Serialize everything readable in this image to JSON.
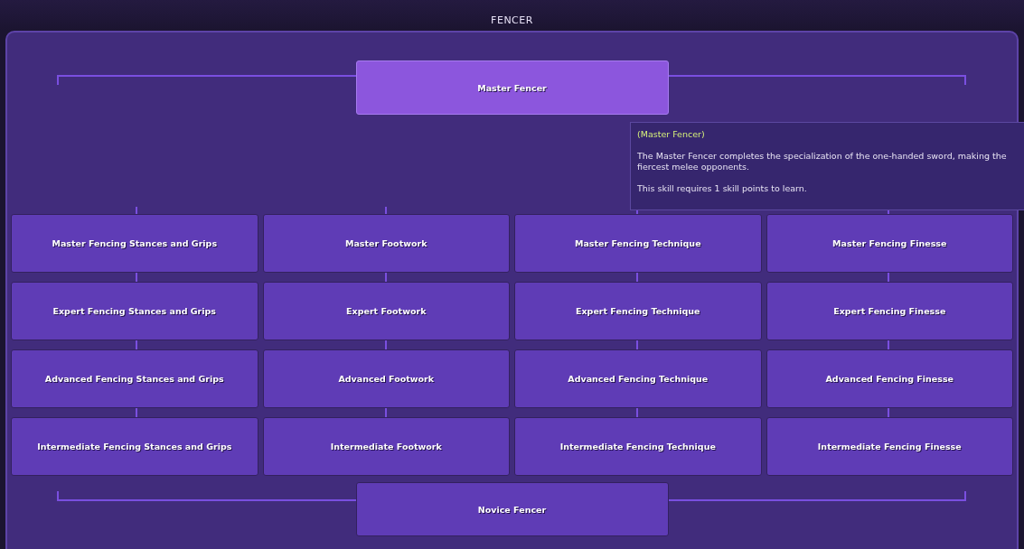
{
  "window": {
    "title": "FENCER"
  },
  "top_skill": {
    "label": "Master Fencer",
    "selected": true
  },
  "tooltip": {
    "title": "(Master Fencer)",
    "description_lines": [
      "The Master Fencer completes the specialization of the one-handed sword, making the",
      "fiercest melee opponents."
    ],
    "requirement": "This skill requires 1 skill points to learn."
  },
  "skill_rows": [
    {
      "skills": [
        {
          "label": "Master Fencing Stances and Grips",
          "selected": false
        },
        {
          "label": "Master Footwork",
          "selected": false
        },
        {
          "label": "Master Fencing Technique",
          "selected": false
        },
        {
          "label": "Master Fencing Finesse",
          "selected": false
        }
      ]
    },
    {
      "skills": [
        {
          "label": "Expert Fencing Stances and Grips",
          "selected": false
        },
        {
          "label": "Expert Footwork",
          "selected": false
        },
        {
          "label": "Expert Fencing Technique",
          "selected": false
        },
        {
          "label": "Expert Fencing Finesse",
          "selected": false
        }
      ]
    },
    {
      "skills": [
        {
          "label": "Advanced Fencing Stances and Grips",
          "selected": false
        },
        {
          "label": "Advanced Footwork",
          "selected": false
        },
        {
          "label": "Advanced Fencing Technique",
          "selected": false
        },
        {
          "label": "Advanced Fencing Finesse",
          "selected": false
        }
      ]
    },
    {
      "skills": [
        {
          "label": "Intermediate Fencing Stances and Grips",
          "selected": false
        },
        {
          "label": "Intermediate Footwork",
          "selected": false
        },
        {
          "label": "Intermediate Fencing Technique",
          "selected": false
        },
        {
          "label": "Intermediate Fencing Finesse",
          "selected": false
        }
      ]
    }
  ],
  "bottom_skill": {
    "label": "Novice Fencer",
    "selected": false
  }
}
